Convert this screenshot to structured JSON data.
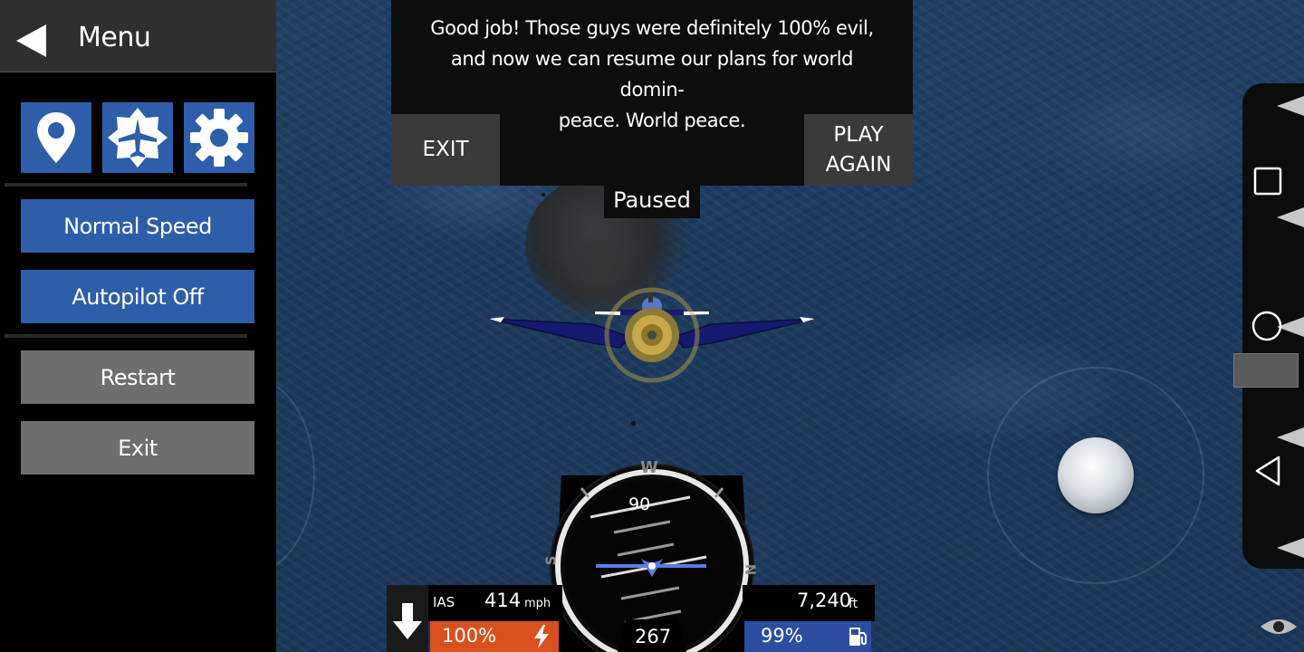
{
  "menu": {
    "title": "Menu",
    "icons": [
      "map-pin-icon",
      "airplane-badge-icon",
      "gear-icon"
    ],
    "speed_label": "Normal Speed",
    "autopilot_label": "Autopilot Off",
    "restart_label": "Restart",
    "exit_label": "Exit"
  },
  "dialog": {
    "message_line1": "Good job! Those guys were definitely 100% evil,",
    "message_line2": "and now we can resume our plans for world domin-",
    "message_line3": "peace. World peace.",
    "exit_label": "EXIT",
    "play_again_line1": "PLAY",
    "play_again_line2": "AGAIN"
  },
  "status": {
    "paused_label": "Paused"
  },
  "hud": {
    "ias_label": "IAS",
    "ias_value": "414",
    "ias_unit": "mph",
    "altitude_value": "7,240",
    "altitude_unit": "ft",
    "throttle_value": "100%",
    "fuel_value": "99%",
    "heading_value": "267",
    "pitch_label": "90",
    "compass": {
      "top": "W",
      "left": "S",
      "right": "N"
    }
  },
  "colors": {
    "menu_blue": "#2e5eaa",
    "menu_gray": "#6e6e6e",
    "throttle_orange": "#d9501f",
    "fuel_blue": "#2b4ea0",
    "ocean": "#1c3a5d"
  },
  "nav": {
    "icons": [
      "square-icon",
      "circle-icon",
      "triangle-back-icon",
      "eye-icon"
    ]
  }
}
